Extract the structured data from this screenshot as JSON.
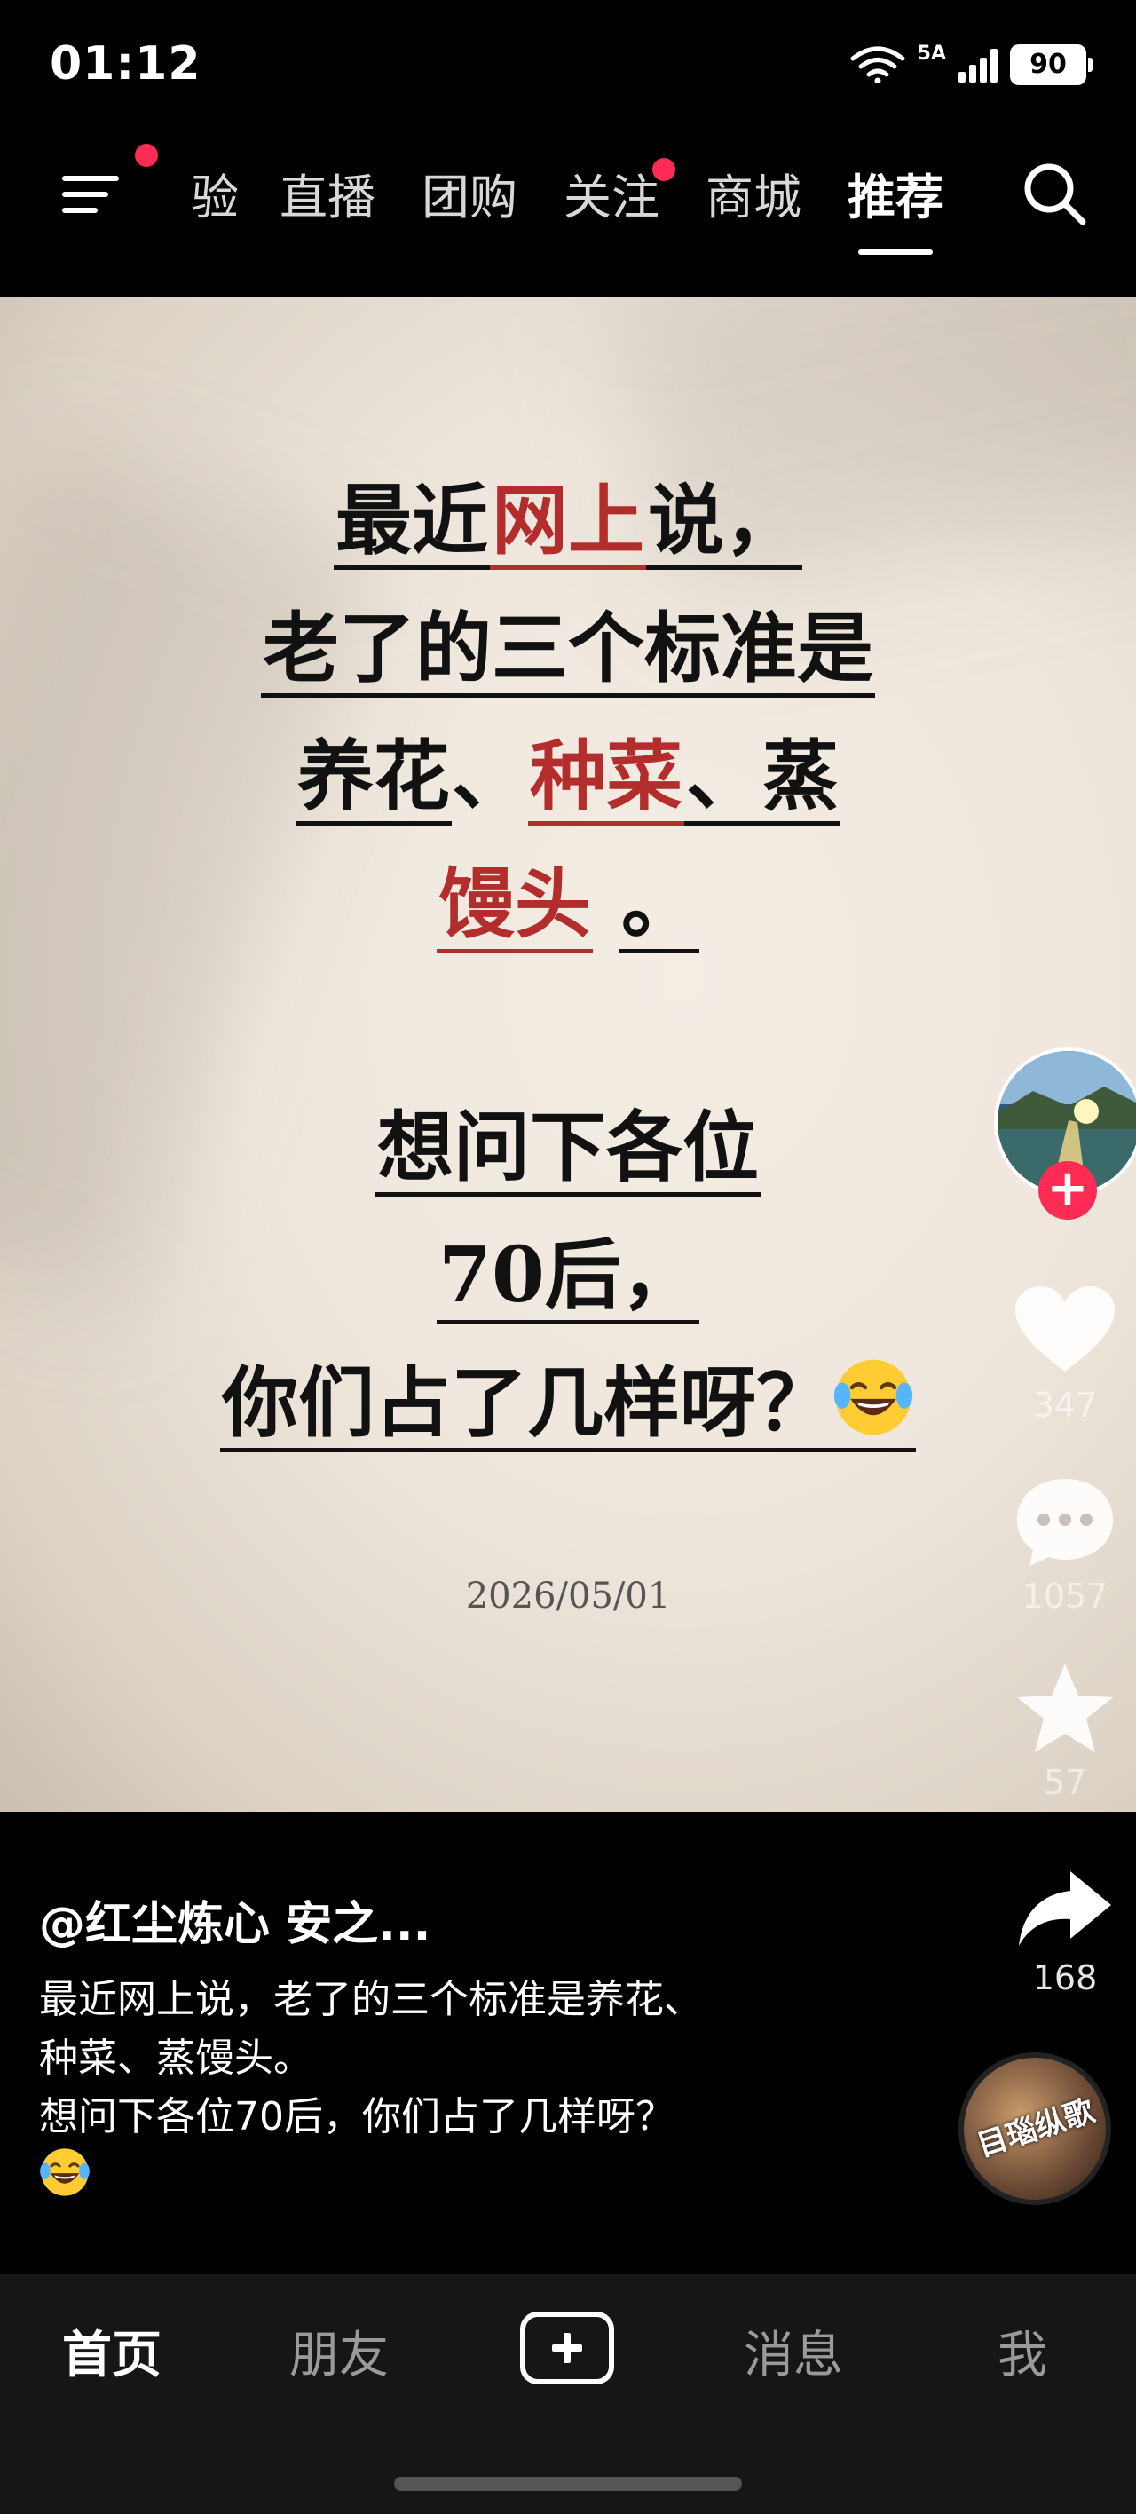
{
  "status_bar": {
    "time": "01:12",
    "network": "5A",
    "battery": "90"
  },
  "top_nav": {
    "tabs": [
      {
        "label": "验",
        "badge": false
      },
      {
        "label": "直播",
        "badge": false
      },
      {
        "label": "团购",
        "badge": false
      },
      {
        "label": "关注",
        "badge": true
      },
      {
        "label": "商城",
        "badge": false
      },
      {
        "label": "推荐",
        "badge": false,
        "active": true
      }
    ],
    "icons": [
      "menu-icon",
      "search-icon"
    ]
  },
  "video": {
    "line1_a": "最近",
    "line1_b": "网上",
    "line1_c": "说，",
    "line2": "老了的三个标准是",
    "line3_a": "养花",
    "line3_b": "、",
    "line3_c": "种菜",
    "line3_d": "、蒸",
    "line4_a": "馒头",
    "line4_b": "。",
    "line5": "想问下各位",
    "line6": "70后，",
    "line7": "你们占了几样呀？",
    "date": "2026/05/01"
  },
  "rail": {
    "follow": "+",
    "likes": "347",
    "comments": "1057",
    "favorites": "57",
    "shares": "168"
  },
  "caption": {
    "author": "@红尘炼心  安之...",
    "line1": "最近网上说，老了的三个标准是养花、",
    "line2": "种菜、蒸馒头。",
    "line3": "想问下各位70后，你们占了几样呀？"
  },
  "music": {
    "label": "目瑙纵歌"
  },
  "bottom_nav": {
    "home": "首页",
    "friends": "朋友",
    "messages": "消息",
    "me": "我"
  },
  "colors": {
    "accent": "#fe2c55",
    "highlight_red": "#b32d2d",
    "paper": "#efe7dd"
  }
}
